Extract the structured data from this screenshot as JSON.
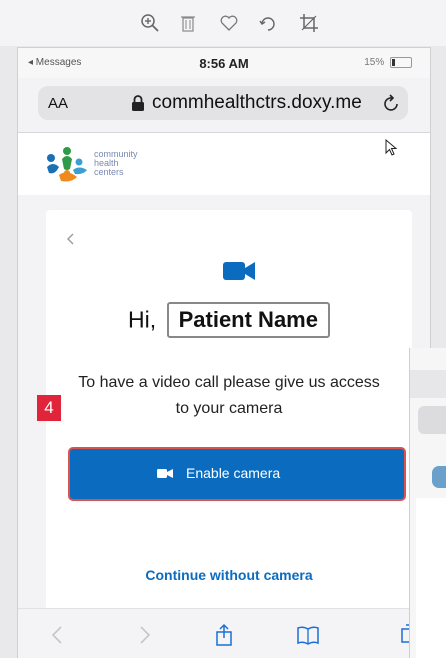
{
  "viewer_toolbar": {
    "icons": [
      "zoom-in-icon",
      "trash-icon",
      "heart-icon",
      "rotate-icon",
      "crop-icon"
    ]
  },
  "status_bar": {
    "carrier": "◂ Messages",
    "time": "8:56 AM",
    "battery": "15%"
  },
  "browser": {
    "text_size_label": "AA",
    "url": "commhealthctrs.doxy.me"
  },
  "site_header": {
    "logo_lines": [
      "community",
      "health",
      "centers"
    ]
  },
  "card": {
    "greeting": "Hi,",
    "patient_name": "Patient Name",
    "message_line1": "To have a video call please give us access",
    "message_line2": "to your camera",
    "enable_button_label": "Enable camera",
    "continue_link": "Continue without camera"
  },
  "annotation": {
    "step_number": "4"
  },
  "colors": {
    "primary_blue": "#0b6cbf",
    "annotation_red": "#e0243a",
    "highlight_outline": "#d9534f"
  }
}
